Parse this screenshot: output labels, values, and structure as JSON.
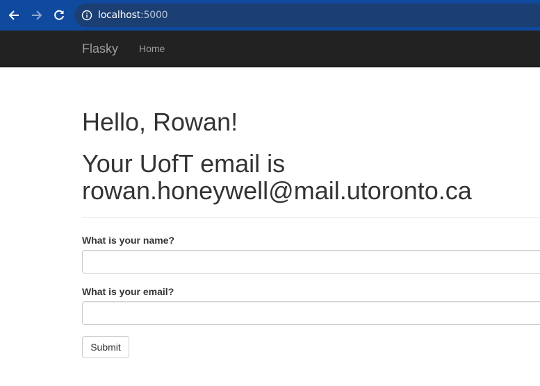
{
  "browser": {
    "url_host": "localhost",
    "url_port": ":5000",
    "icons": [
      "back-arrow-icon",
      "forward-arrow-icon",
      "reload-icon",
      "info-icon"
    ]
  },
  "navbar": {
    "brand": "Flasky",
    "links": [
      {
        "label": "Home"
      }
    ]
  },
  "main": {
    "greeting": "Hello, Rowan!",
    "email_line1": "Your UofT email is",
    "email_line2": "rowan.honeywell@mail.utoronto.ca"
  },
  "form": {
    "name_label": "What is your name?",
    "name_value": "",
    "email_label": "What is your email?",
    "email_value": "",
    "submit_label": "Submit"
  }
}
